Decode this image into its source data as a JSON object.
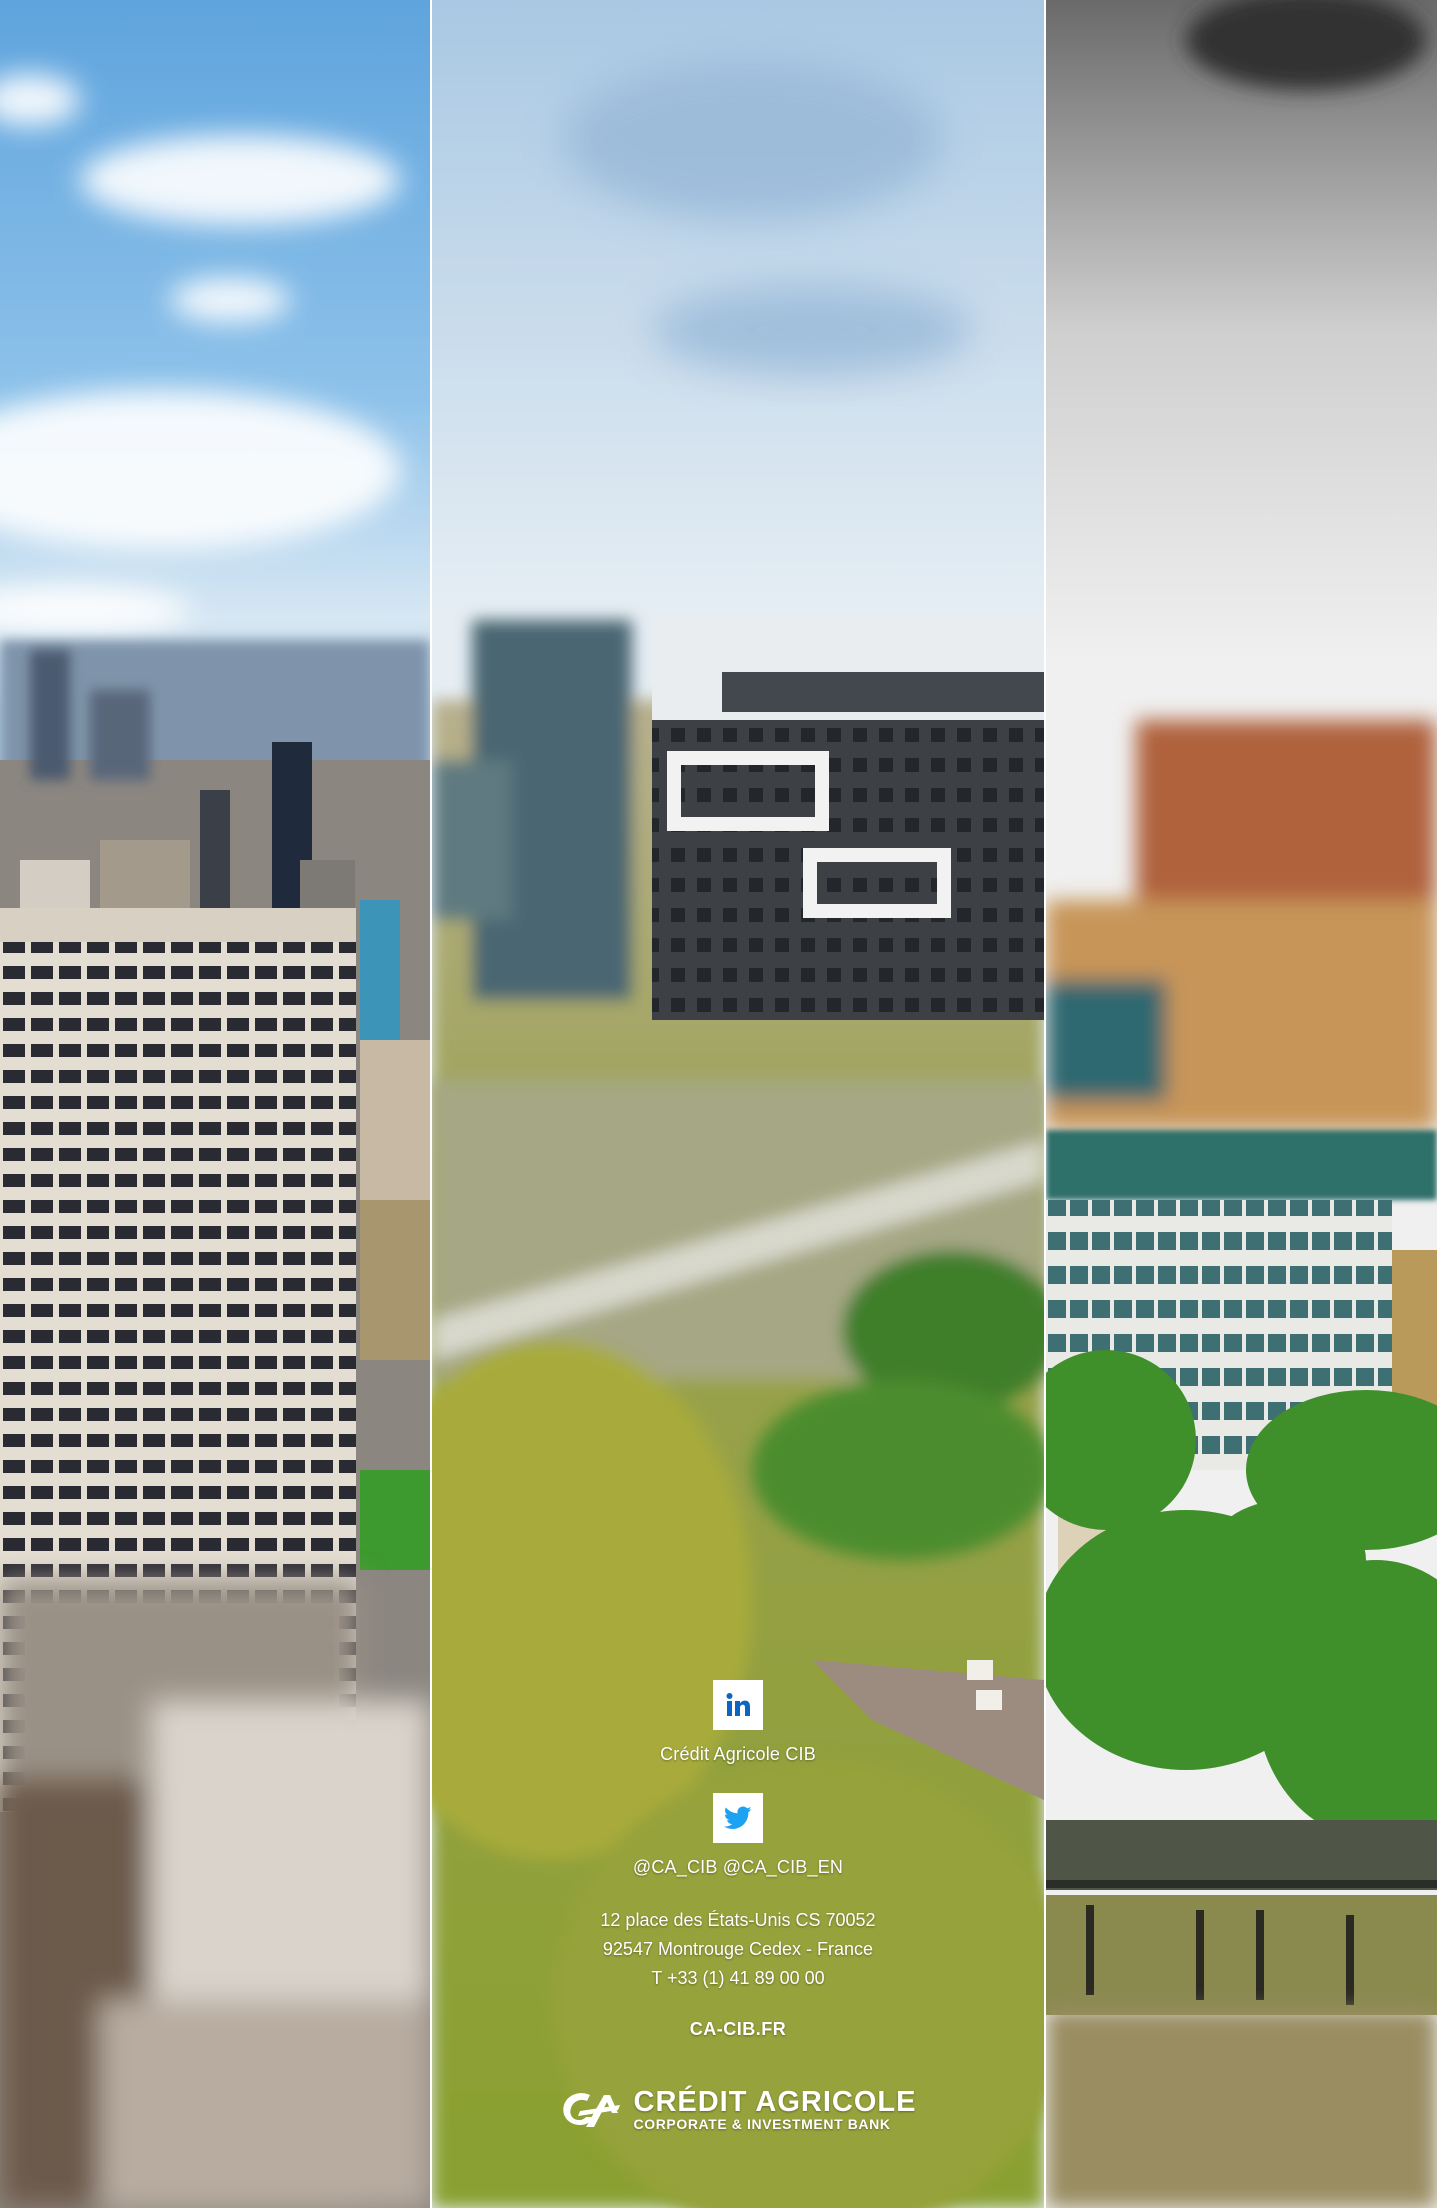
{
  "social": {
    "linkedin": {
      "icon": "linkedin-icon",
      "label": "Crédit Agricole CIB"
    },
    "twitter": {
      "icon": "twitter-icon",
      "label": "@CA_CIB @CA_CIB_EN"
    }
  },
  "address": {
    "line1": "12 place des États-Unis CS 70052",
    "line2": "92547 Montrouge Cedex - France",
    "phone": "T +33 (1) 41 89 00 00"
  },
  "website": "CA-CIB.FR",
  "brand": {
    "name": "CRÉDIT AGRICOLE",
    "tagline": "CORPORATE & INVESTMENT BANK",
    "logo_icon": "credit-agricole-logo-icon"
  },
  "colors": {
    "text": "#ffffff",
    "twitter_blue": "#1da1f2",
    "linkedin_blue": "#0a66c2"
  }
}
